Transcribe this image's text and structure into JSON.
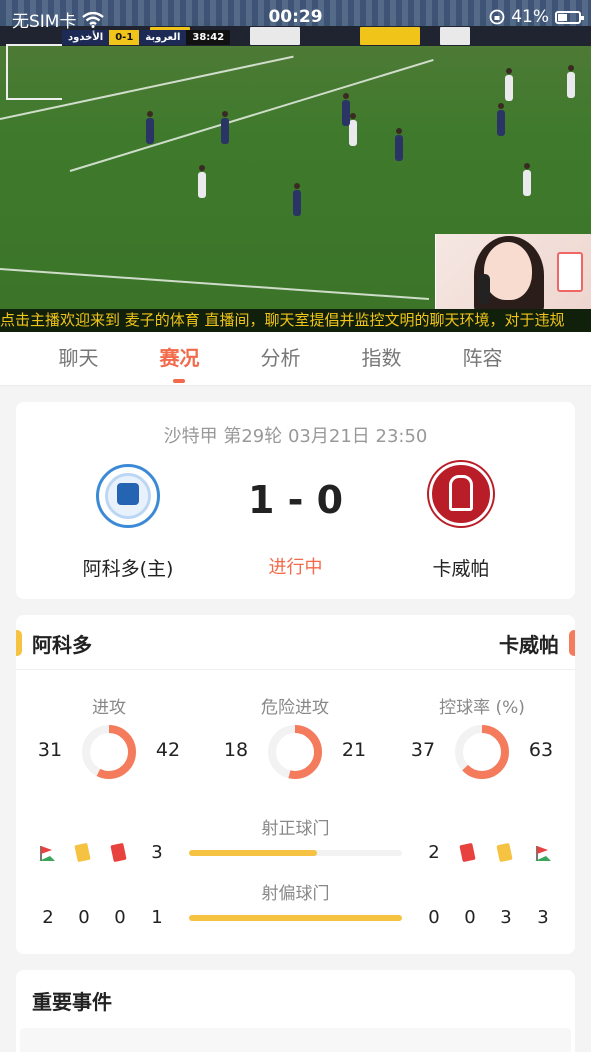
{
  "status_bar": {
    "carrier": "无SIM卡",
    "time": "00:29",
    "battery": "41%"
  },
  "video": {
    "scorebug": {
      "home": "الأخدود",
      "score": "0-1",
      "away": "العروبة",
      "clock": "38:42"
    },
    "marquee": "点击主播欢迎来到 麦子的体育 直播间，聊天室提倡并监控文明的聊天环境，对于违规"
  },
  "tabs": [
    {
      "label": "聊天",
      "active": false
    },
    {
      "label": "赛况",
      "active": true
    },
    {
      "label": "分析",
      "active": false
    },
    {
      "label": "指数",
      "active": false
    },
    {
      "label": "阵容",
      "active": false
    }
  ],
  "match": {
    "league_line": "沙特甲  第29轮  03月21日 23:50",
    "score": "1 - 0",
    "status": "进行中",
    "home_name": "阿科多(主)",
    "away_name": "卡威帕",
    "home_logo": "al-okhdood-club-crest",
    "away_logo": "away-club-crest"
  },
  "stats": {
    "home_team": "阿科多",
    "away_team": "卡威帕",
    "colors": {
      "home": "#f5c242",
      "away": "#f47c5d",
      "ring_bg": "#f2f2f2"
    },
    "metrics": [
      {
        "label": "进攻",
        "home": "31",
        "away": "42"
      },
      {
        "label": "危险进攻",
        "home": "18",
        "away": "21"
      },
      {
        "label": "控球率 (%)",
        "home": "37",
        "away": "63"
      }
    ],
    "on_target": {
      "label": "射正球门",
      "home_corners_icon": "corner-flag-icon",
      "home_yellow_icon": "yellow-card-icon",
      "home_red_icon": "red-card-icon",
      "home": "3",
      "away": "2",
      "home_fill": 0.6
    },
    "off_target": {
      "label": "射偏球门",
      "home_corners": "2",
      "home_yellow": "0",
      "home_red": "0",
      "home": "1",
      "away": "0",
      "away_red": "0",
      "away_yellow": "3",
      "away_corners": "3",
      "home_fill": 1.0
    }
  },
  "events": {
    "title": "重要事件"
  }
}
